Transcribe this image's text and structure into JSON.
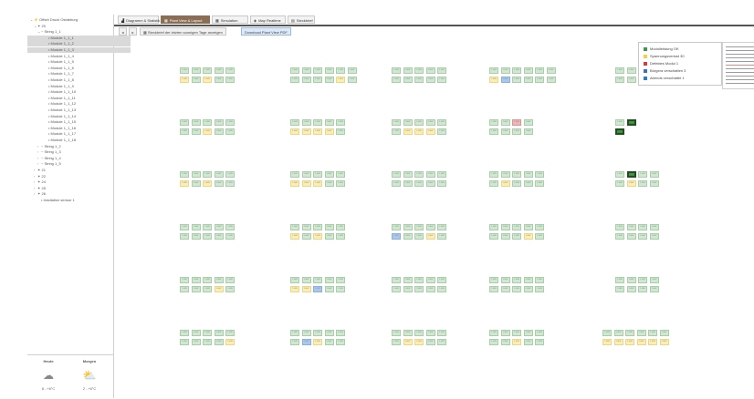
{
  "sidebar": {
    "tree": [
      {
        "label": "Offset Druck Ostdeburg",
        "indent": 0,
        "arrow": "⌄",
        "bolt": true,
        "selected": false
      },
      {
        "label": "20",
        "indent": 1,
        "arrow": "⌄",
        "prefix": "✶",
        "selected": false
      },
      {
        "label": "String 1_1",
        "indent": 2,
        "arrow": "⌄",
        "prefix": "~",
        "selected": false
      },
      {
        "label": "Module 1_1_1",
        "indent": 4,
        "arrow": "",
        "prefix": "•",
        "selected": true
      },
      {
        "label": "Module 1_1_2",
        "indent": 4,
        "arrow": "",
        "prefix": "•",
        "selected": true
      },
      {
        "label": "Module 1_1_3",
        "indent": 4,
        "arrow": "",
        "prefix": "•",
        "selected": true
      },
      {
        "label": "Module 1_1_4",
        "indent": 4,
        "arrow": "",
        "prefix": "•",
        "selected": false
      },
      {
        "label": "Module 1_1_5",
        "indent": 4,
        "arrow": "",
        "prefix": "•",
        "selected": false
      },
      {
        "label": "Module 1_1_6",
        "indent": 4,
        "arrow": "",
        "prefix": "•",
        "selected": false
      },
      {
        "label": "Module 1_1_7",
        "indent": 4,
        "arrow": "",
        "prefix": "•",
        "selected": false
      },
      {
        "label": "Module 1_1_8",
        "indent": 4,
        "arrow": "",
        "prefix": "•",
        "selected": false
      },
      {
        "label": "Module 1_1_9",
        "indent": 4,
        "arrow": "",
        "prefix": "•",
        "selected": false
      },
      {
        "label": "Module 1_1_10",
        "indent": 4,
        "arrow": "",
        "prefix": "•",
        "selected": false
      },
      {
        "label": "Module 1_1_11",
        "indent": 4,
        "arrow": "",
        "prefix": "•",
        "selected": false
      },
      {
        "label": "Module 1_1_12",
        "indent": 4,
        "arrow": "",
        "prefix": "•",
        "selected": false
      },
      {
        "label": "Module 1_1_13",
        "indent": 4,
        "arrow": "",
        "prefix": "•",
        "selected": false
      },
      {
        "label": "Module 1_1_14",
        "indent": 4,
        "arrow": "",
        "prefix": "•",
        "selected": false
      },
      {
        "label": "Module 1_1_15",
        "indent": 4,
        "arrow": "",
        "prefix": "•",
        "selected": false
      },
      {
        "label": "Module 1_1_16",
        "indent": 4,
        "arrow": "",
        "prefix": "•",
        "selected": false
      },
      {
        "label": "Module 1_1_17",
        "indent": 4,
        "arrow": "",
        "prefix": "•",
        "selected": false
      },
      {
        "label": "Module 1_1_18",
        "indent": 4,
        "arrow": "",
        "prefix": "•",
        "selected": false
      },
      {
        "label": "String 1_2",
        "indent": 2,
        "arrow": "›",
        "prefix": "~",
        "selected": false
      },
      {
        "label": "String 1_3",
        "indent": 2,
        "arrow": "›",
        "prefix": "~",
        "selected": false
      },
      {
        "label": "String 1_4",
        "indent": 2,
        "arrow": "›",
        "prefix": "~",
        "selected": false
      },
      {
        "label": "String 1_5",
        "indent": 2,
        "arrow": "›",
        "prefix": "~",
        "selected": false
      },
      {
        "label": "21",
        "indent": 1,
        "arrow": "›",
        "prefix": "✶",
        "selected": false
      },
      {
        "label": "22",
        "indent": 1,
        "arrow": "›",
        "prefix": "✶",
        "selected": false
      },
      {
        "label": "24",
        "indent": 1,
        "arrow": "›",
        "prefix": "✶",
        "selected": false
      },
      {
        "label": "25",
        "indent": 1,
        "arrow": "›",
        "prefix": "✶",
        "selected": false
      },
      {
        "label": "26",
        "indent": 1,
        "arrow": "›",
        "prefix": "✶",
        "selected": false
      },
      {
        "label": "Irradiation sensor 1",
        "indent": 2,
        "arrow": "",
        "prefix": "•",
        "selected": false
      }
    ],
    "weather": {
      "today": {
        "title": "Heute",
        "icon": "rain-cloud-icon",
        "value": "8 ..+6°C"
      },
      "tomorrow": {
        "title": "Morgen",
        "icon": "sun-cloud-icon",
        "value": "2 ..+6°C"
      }
    }
  },
  "tabs": [
    {
      "label": "Diagramm & Statistik",
      "icon": "chart-icon",
      "active": false
    },
    {
      "label": "Plant View & Layout",
      "icon": "layout-icon",
      "active": true
    },
    {
      "label": "Simulation",
      "icon": "grid-icon",
      "active": false
    },
    {
      "label": "Map Realtime",
      "icon": "map-icon",
      "active": false
    },
    {
      "label": "Steckbrief",
      "icon": "card-icon",
      "active": false
    }
  ],
  "toolbar": {
    "btn1": "",
    "btn2": "",
    "show_last_days": "Steckbrief der letzten sonnigen Tage anzeigen",
    "download_pdf": "Download Plant View PDF"
  },
  "legend": [
    {
      "label": "Modulleistung OK",
      "color": "#3a9a4a"
    },
    {
      "label": "Spannungsverlust 30",
      "color": "#f2d04a"
    },
    {
      "label": "Defektes Modul 1",
      "color": "#d83a3a"
    },
    {
      "label": "Bürgera verschatten 3",
      "color": "#3a6fc8"
    },
    {
      "label": "Abends verschattet 1",
      "color": "#2a7ec8"
    }
  ],
  "panel_label": "1.0kW",
  "panel_rows": [
    {
      "groups": [
        {
          "top": "GGGGG",
          "bot": "YGYGG"
        },
        {
          "top": "GGGGGG",
          "bot": "GGGGYG"
        },
        {
          "top": "GGGGG",
          "bot": "GGGGG"
        },
        {
          "top": "GGGGGG",
          "bot": "YBGGGG"
        },
        {
          "top": "GG",
          "bot": "GG"
        }
      ]
    },
    {
      "groups": [
        {
          "top": "GGGGG",
          "bot": "GGYGG"
        },
        {
          "top": "GGGGG",
          "bot": "YYYYG"
        },
        {
          "top": "GGGGG",
          "bot": "GYYYG"
        },
        {
          "top": "GGRG",
          "bot": "GGGG"
        },
        {
          "top": "GD",
          "bot": "D"
        }
      ]
    },
    {
      "groups": [
        {
          "top": "GGGGG",
          "bot": "YGYGG"
        },
        {
          "top": "GGGGG",
          "bot": "YYYGG"
        },
        {
          "top": "GGGGG",
          "bot": "GGGGG"
        },
        {
          "top": "GGGGG",
          "bot": "GYGGG"
        },
        {
          "top": "GDGG",
          "bot": "GYGG"
        }
      ]
    },
    {
      "groups": [
        {
          "top": "GGGGG",
          "bot": "GGGGG"
        },
        {
          "top": "GGGGG",
          "bot": "YGYGG"
        },
        {
          "top": "GGGGG",
          "bot": "BGGYG"
        },
        {
          "top": "GGGGG",
          "bot": "GGGYG"
        },
        {
          "top": "GGGG",
          "bot": "GGGG"
        }
      ]
    },
    {
      "groups": [
        {
          "top": "GGGGG",
          "bot": "GGGYG"
        },
        {
          "top": "GGGGG",
          "bot": "YYBGG"
        },
        {
          "top": "GGGGG",
          "bot": "GGGGG"
        },
        {
          "top": "GGGGG",
          "bot": "GGGGG"
        },
        {
          "top": "GGGG",
          "bot": "GGGG"
        }
      ]
    },
    {
      "groups": [
        {
          "top": "GGGGG",
          "bot": "GGGGY"
        },
        {
          "top": "GGGGG",
          "bot": "GBYGG"
        },
        {
          "top": "GGGGG",
          "bot": "GYYGG"
        },
        {
          "top": "GGGGG",
          "bot": "GGYGG"
        },
        {
          "top": "GGGGGG",
          "bot": "YYYYYY"
        }
      ]
    }
  ]
}
